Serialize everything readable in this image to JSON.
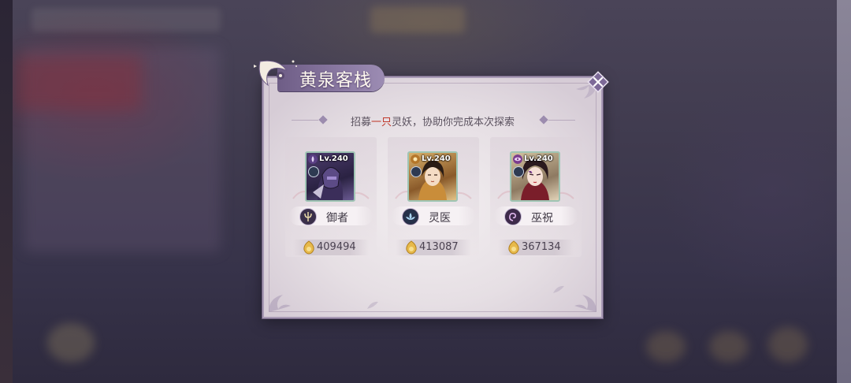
{
  "dialog": {
    "title": "黄泉客栈",
    "subtitle_before": "招募",
    "subtitle_highlight": "一只",
    "subtitle_after": "灵妖，协助你完成本次探索"
  },
  "colors": {
    "highlight": "#c0392b",
    "banner": "#8a79a2",
    "portrait_border": "#9fc5b4"
  },
  "cards": [
    {
      "level": "Lv.240",
      "role": "御者",
      "role_icon": "trident-icon",
      "element_icon": "purple-flame-icon",
      "price": "409494"
    },
    {
      "level": "Lv.240",
      "role": "灵医",
      "role_icon": "lotus-icon",
      "element_icon": "sun-icon",
      "price": "413087"
    },
    {
      "level": "Lv.240",
      "role": "巫祝",
      "role_icon": "spiral-icon",
      "element_icon": "purple-eye-icon",
      "price": "367134"
    }
  ]
}
